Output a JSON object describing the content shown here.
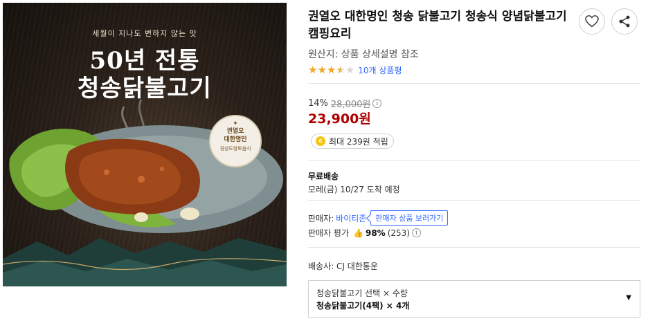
{
  "product_image": {
    "tagline": "세월이 지나도 변하지 않는 맛",
    "headline_line1": "50년 전통",
    "headline_line2": "청송닭불고기",
    "badge_line1": "권열오",
    "badge_line2": "대한명인",
    "badge_line3": "경상도향토음식"
  },
  "product": {
    "title": "권열오 대한명인 청송 닭불고기 청송식 양념닭불고기 캠핑요리",
    "origin": "원산지: 상품 상세설명 참조",
    "rating_stars": 3.5,
    "review_link": "10개 상품평"
  },
  "price": {
    "discount": "14%",
    "original": "28,000원",
    "sale": "23,900원",
    "reward": "최대 239원 적립"
  },
  "shipping": {
    "label": "무료배송",
    "arrival": "모레(금) 10/27 도착 예정"
  },
  "seller": {
    "label": "판매자:",
    "name": "바이티존",
    "tip": "판매자 상품 보러가기",
    "rating_label": "판매자 평가",
    "rating_pct": "98%",
    "rating_count": "(253)"
  },
  "carrier": "배송사: CJ 대한통운",
  "option": {
    "header": "청송닭불고기 선택 × 수량",
    "selected": "청송닭불고기(4팩) × 4개"
  },
  "icons": {
    "wishlist": "heart-icon",
    "share": "share-icon",
    "info": "info-icon",
    "coin": "coin-icon",
    "thumb": "thumbs-up-icon",
    "caret": "caret-down-icon"
  },
  "colors": {
    "price_red": "#ae0000",
    "link_blue": "#346aff",
    "star_gold": "#f5a623",
    "coin_yellow": "#f6c416"
  }
}
